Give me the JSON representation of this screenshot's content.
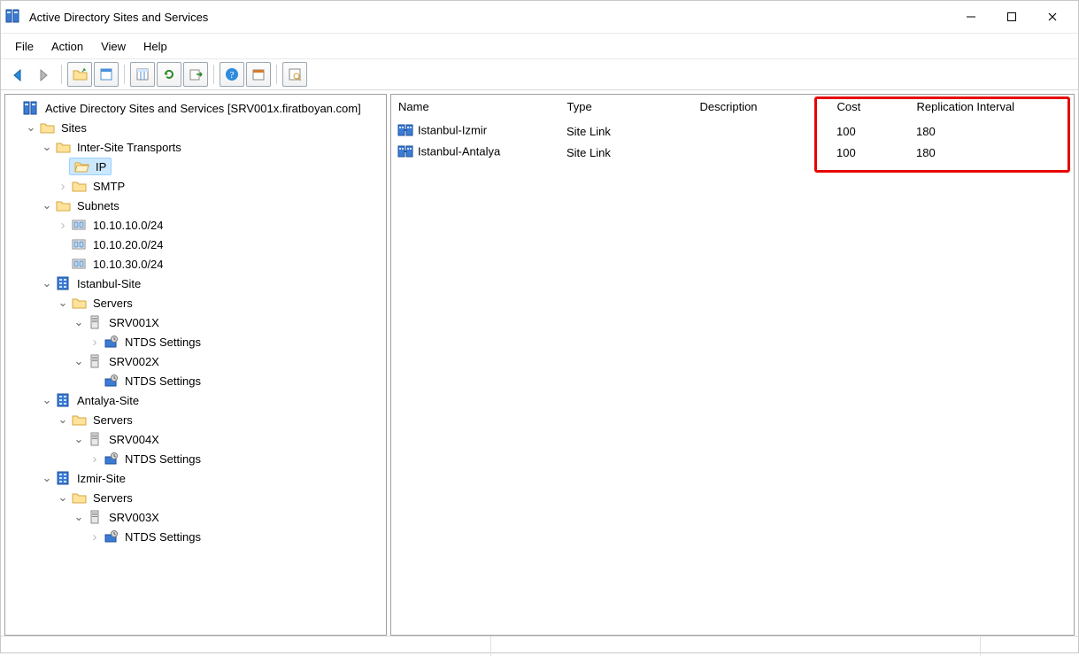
{
  "window": {
    "title": "Active Directory Sites and Services"
  },
  "menu": {
    "file": "File",
    "action": "Action",
    "view": "View",
    "help": "Help"
  },
  "toolbar": {
    "back": "back",
    "forward": "forward",
    "up": "up-folder",
    "props": "properties",
    "export": "export-list",
    "refresh": "refresh",
    "export2": "export",
    "help": "help",
    "col": "column-options",
    "find": "find"
  },
  "tree": {
    "root": "Active Directory Sites and Services [SRV001x.firatboyan.com]",
    "sites": "Sites",
    "ist": "Inter-Site Transports",
    "ip": "IP",
    "smtp": "SMTP",
    "subnets": "Subnets",
    "sn1": "10.10.10.0/24",
    "sn2": "10.10.20.0/24",
    "sn3": "10.10.30.0/24",
    "site1": "Istanbul-Site",
    "site2": "Antalya-Site",
    "site3": "Izmir-Site",
    "servers": "Servers",
    "srv1": "SRV001X",
    "srv2": "SRV002X",
    "srv3": "SRV003X",
    "srv4": "SRV004X",
    "ntds": "NTDS Settings"
  },
  "list": {
    "headers": {
      "name": "Name",
      "type": "Type",
      "description": "Description",
      "cost": "Cost",
      "repl": "Replication Interval"
    },
    "rows": [
      {
        "name": "Istanbul-Izmir",
        "type": "Site Link",
        "description": "",
        "cost": "100",
        "repl": "180"
      },
      {
        "name": "Istanbul-Antalya",
        "type": "Site Link",
        "description": "",
        "cost": "100",
        "repl": "180"
      }
    ]
  }
}
